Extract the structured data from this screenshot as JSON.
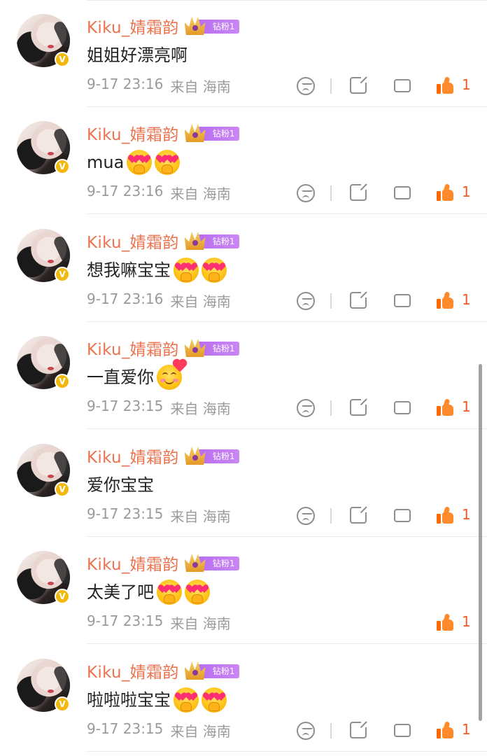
{
  "comments": [
    {
      "username": "Kiku_婧霜韵",
      "badge": "钻粉1",
      "text": "姐姐好漂亮啊",
      "emojis": [],
      "time": "9-17 23:16",
      "location": "来自 海南",
      "likes": "1",
      "show_actions": true
    },
    {
      "username": "Kiku_婧霜韵",
      "badge": "钻粉1",
      "text": "mua",
      "emojis": [
        "heart-eyes",
        "heart-eyes"
      ],
      "time": "9-17 23:16",
      "location": "来自 海南",
      "likes": "1",
      "show_actions": true
    },
    {
      "username": "Kiku_婧霜韵",
      "badge": "钻粉1",
      "text": "想我嘛宝宝",
      "emojis": [
        "heart-eyes",
        "heart-eyes"
      ],
      "time": "9-17 23:16",
      "location": "来自 海南",
      "likes": "1",
      "show_actions": true
    },
    {
      "username": "Kiku_婧霜韵",
      "badge": "钻粉1",
      "text": "一直爱你",
      "emojis": [
        "smiling-hearts"
      ],
      "time": "9-17 23:15",
      "location": "来自 海南",
      "likes": "1",
      "show_actions": true
    },
    {
      "username": "Kiku_婧霜韵",
      "badge": "钻粉1",
      "text": "爱你宝宝",
      "emojis": [],
      "time": "9-17 23:15",
      "location": "来自 海南",
      "likes": "1",
      "show_actions": true
    },
    {
      "username": "Kiku_婧霜韵",
      "badge": "钻粉1",
      "text": "太美了吧",
      "emojis": [
        "heart-eyes",
        "heart-eyes"
      ],
      "time": "9-17 23:15",
      "location": "来自 海南",
      "likes": "1",
      "show_actions": false
    },
    {
      "username": "Kiku_婧霜韵",
      "badge": "钻粉1",
      "text": "啦啦啦宝宝",
      "emojis": [
        "heart-eyes",
        "heart-eyes"
      ],
      "time": "9-17 23:15",
      "location": "来自 海南",
      "likes": "1",
      "show_actions": true
    }
  ],
  "colors": {
    "username": "#eb7350",
    "like_count": "#ef5a24",
    "meta": "#9a9a9a",
    "verified": "#f3b80d",
    "fan_badge": "#b86cf0"
  },
  "icons": {
    "dislike": "sad-face-icon",
    "share": "share-icon",
    "reply": "comment-bubble-icon",
    "like": "thumbs-up-icon",
    "verified": "verified-v-icon"
  }
}
